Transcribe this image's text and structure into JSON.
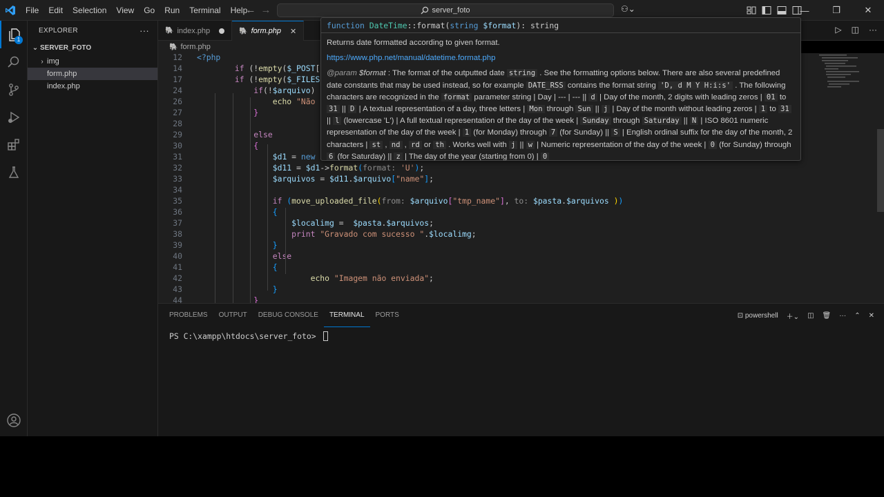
{
  "titlebar": {
    "menu": [
      "File",
      "Edit",
      "Selection",
      "View",
      "Go",
      "Run",
      "Terminal",
      "Help"
    ],
    "search_text": "server_foto"
  },
  "sidebar": {
    "title": "EXPLORER",
    "folder": "SERVER_FOTO",
    "items": [
      {
        "label": "img",
        "type": "folder"
      },
      {
        "label": "form.php",
        "type": "file"
      },
      {
        "label": "index.php",
        "type": "file"
      }
    ],
    "badge": "1"
  },
  "tabs": [
    {
      "label": "index.php"
    },
    {
      "label": "form.php"
    }
  ],
  "breadcrumb": {
    "file": "form.php"
  },
  "editor": {
    "lines": [
      {
        "n": "12",
        "html": "<span class='tag'>&lt;?php</span>"
      },
      {
        "n": "14",
        "html": "        <span class='kw'>if</span> (!<span class='fn'>empty</span>(<span class='var'>$_POST</span>[<span class='str'>\"a</span>"
      },
      {
        "n": "17",
        "html": "        <span class='kw'>if</span> (!<span class='fn'>empty</span>(<span class='var'>$_FILES</span>[<span class='str'>\"</span>"
      },
      {
        "n": "24",
        "html": "            <span class='kw'>if</span>(!<span class='var'>$arquivo</span>)"
      },
      {
        "n": "26",
        "html": "                <span class='fn'>echo</span> <span class='str'>\"Não ac</span>"
      },
      {
        "n": "27",
        "html": "            <span class='brk2'>}</span>"
      },
      {
        "n": "28",
        "html": ""
      },
      {
        "n": "29",
        "html": "            <span class='kw'>else</span>"
      },
      {
        "n": "30",
        "html": "            <span class='brk2'>{</span>"
      },
      {
        "n": "31",
        "html": "                <span class='var'>$d1</span> = <span class='tag'>new</span> <span class='cls'>Da</span>"
      },
      {
        "n": "32",
        "html": "                <span class='var'>$d11</span> = <span class='var'>$d1</span>-&gt;<span class='fn'>format</span><span class='brk3'>(</span><span class='hint'>format: </span><span class='str'>'U'</span><span class='brk3'>)</span>;"
      },
      {
        "n": "33",
        "html": "                <span class='var'>$arquivos</span> = <span class='var'>$d11</span>.<span class='var'>$arquivo</span><span class='brk3'>[</span><span class='str'>\"name\"</span><span class='brk3'>]</span>;"
      },
      {
        "n": "34",
        "html": ""
      },
      {
        "n": "35",
        "html": "                <span class='kw'>if</span> <span class='brk3'>(</span><span class='fn'>move_uploaded_file</span><span class='brk'>(</span><span class='hint'>from: </span><span class='var'>$arquivo</span><span class='brk2'>[</span><span class='str'>\"tmp_name\"</span><span class='brk2'>]</span>, <span class='hint'>to: </span><span class='var'>$pasta</span>.<span class='var'>$arquivos</span> <span class='brk'>)</span><span class='brk3'>)</span>"
      },
      {
        "n": "36",
        "html": "                <span class='brk3'>{</span>"
      },
      {
        "n": "37",
        "html": "                    <span class='var'>$localimg</span> =  <span class='var'>$pasta</span>.<span class='var'>$arquivos</span>;"
      },
      {
        "n": "38",
        "html": "                    <span class='kw'>print</span> <span class='str'>\"Gravado com sucesso \"</span>.<span class='var'>$localimg</span>;"
      },
      {
        "n": "39",
        "html": "                <span class='brk3'>}</span>"
      },
      {
        "n": "40",
        "html": "                <span class='kw'>else</span>"
      },
      {
        "n": "41",
        "html": "                <span class='brk3'>{</span>"
      },
      {
        "n": "42",
        "html": "                        <span class='fn'>echo</span> <span class='str'>\"Imagem não enviada\"</span>;"
      },
      {
        "n": "43",
        "html": "                <span class='brk3'>}</span>"
      },
      {
        "n": "44",
        "html": "            <span class='brk2'>}</span>"
      }
    ]
  },
  "hover": {
    "signature_keyword": "function",
    "signature_class": "DateTime",
    "signature_rest": "::format(",
    "signature_param_type": "string",
    "signature_param": "$format",
    "signature_ret": "): string",
    "summary": "Returns date formatted according to given format.",
    "link": "https://www.php.net/manual/datetime.format.php",
    "param_tag": "@param",
    "param_name": "$format"
  },
  "panel": {
    "tabs": [
      "PROBLEMS",
      "OUTPUT",
      "DEBUG CONSOLE",
      "TERMINAL",
      "PORTS"
    ],
    "active_tab": "TERMINAL",
    "shell": "powershell",
    "prompt": "PS C:\\xampp\\htdocs\\server_foto> "
  },
  "colors": {
    "accent": "#0078d4",
    "editor_bg": "#1f1f1f",
    "sidebar_bg": "#181818"
  }
}
